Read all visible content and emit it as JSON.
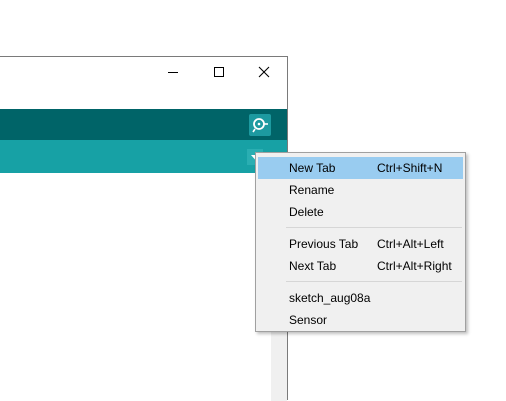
{
  "window": {
    "controls": {
      "minimize": "minimize-icon",
      "maximize": "maximize-icon",
      "close": "close-icon"
    }
  },
  "toolbar": {
    "serial_monitor_icon": "serial-monitor-icon"
  },
  "tabbar": {
    "menu_icon": "chevron-down-icon"
  },
  "colors": {
    "toolbar": "#006468",
    "tabbar": "#17a1a5",
    "menu_bg": "#f0f0f0",
    "menu_highlight": "#99ccf0"
  },
  "context_menu": {
    "items": [
      {
        "label": "New Tab",
        "shortcut": "Ctrl+Shift+N"
      },
      {
        "label": "Rename",
        "shortcut": ""
      },
      {
        "label": "Delete",
        "shortcut": ""
      },
      {
        "label": "Previous Tab",
        "shortcut": "Ctrl+Alt+Left"
      },
      {
        "label": "Next Tab",
        "shortcut": "Ctrl+Alt+Right"
      },
      {
        "label": "sketch_aug08a",
        "shortcut": ""
      },
      {
        "label": "Sensor",
        "shortcut": ""
      }
    ]
  }
}
